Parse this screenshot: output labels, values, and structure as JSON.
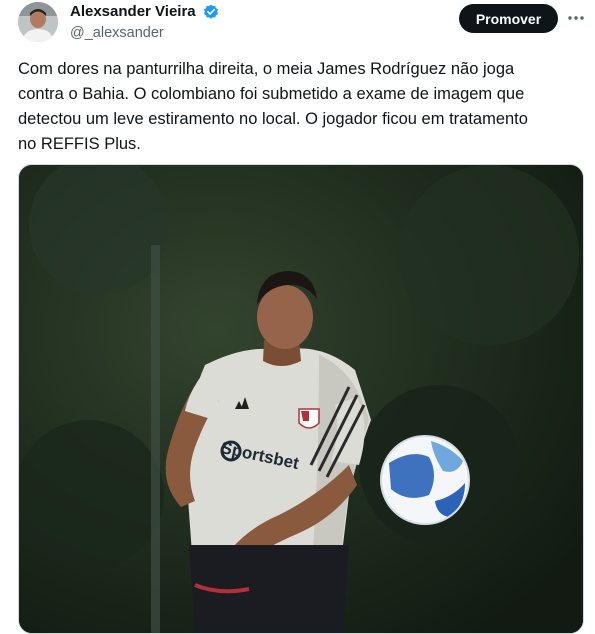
{
  "tweet": {
    "author": {
      "name": "Alexsander Vieira",
      "handle": "@_alexsander",
      "verified": true
    },
    "promote_label": "Promover",
    "text": "Com dores na panturrilha direita, o meia James Rodríguez não joga\ncontra o Bahia. O colombiano foi submetido a exame de imagem que\ndetectou um leve estiramento no local. O jogador ficou em tratamento\nno REFFIS Plus.",
    "media": {
      "shirt_logo_text": "Sportsbet"
    }
  },
  "colors": {
    "verified_badge": "#1d9bf0",
    "promote_button_bg": "#0f1419",
    "text_primary": "#0f1419",
    "text_secondary": "#536471"
  },
  "icons": {
    "verified": "verified-badge-icon",
    "more": "more-horizontal-icon"
  }
}
